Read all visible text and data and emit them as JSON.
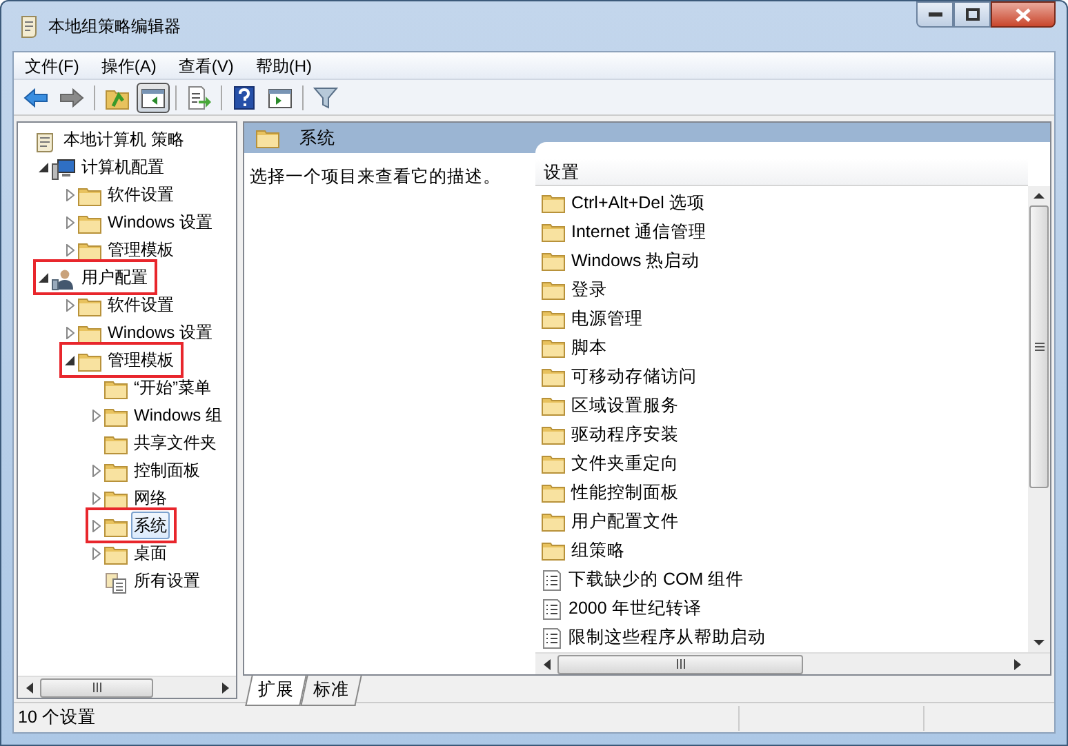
{
  "window": {
    "title": "本地组策略编辑器"
  },
  "menu": [
    "文件(F)",
    "操作(A)",
    "查看(V)",
    "帮助(H)"
  ],
  "toolbar": [
    {
      "kind": "back",
      "pressed": false
    },
    {
      "kind": "forward",
      "pressed": false
    },
    {
      "kind": "sep"
    },
    {
      "kind": "up",
      "pressed": false
    },
    {
      "kind": "tree",
      "pressed": true
    },
    {
      "kind": "sep"
    },
    {
      "kind": "export",
      "pressed": false
    },
    {
      "kind": "sep"
    },
    {
      "kind": "help",
      "pressed": false
    },
    {
      "kind": "view",
      "pressed": false
    },
    {
      "kind": "sep"
    },
    {
      "kind": "filter",
      "pressed": false
    }
  ],
  "tree": [
    {
      "text": "本地计算机 策略",
      "kind": "scroll",
      "selected": false,
      "highlighted": false,
      "children": [
        {
          "text": "计算机配置",
          "kind": "computer",
          "expanded": true,
          "selected": false,
          "highlighted": false,
          "children": [
            {
              "text": "软件设置",
              "kind": "folder",
              "expanded": false,
              "selected": false,
              "highlighted": false
            },
            {
              "text": "Windows 设置",
              "kind": "folder",
              "expanded": false,
              "selected": false,
              "highlighted": false
            },
            {
              "text": "管理模板",
              "kind": "folder",
              "expanded": false,
              "selected": false,
              "highlighted": false
            }
          ]
        },
        {
          "text": "用户配置",
          "kind": "user",
          "expanded": true,
          "selected": false,
          "highlighted": true,
          "children": [
            {
              "text": "软件设置",
              "kind": "folder",
              "expanded": false,
              "selected": false,
              "highlighted": false
            },
            {
              "text": "Windows 设置",
              "kind": "folder",
              "expanded": false,
              "selected": false,
              "highlighted": false
            },
            {
              "text": "管理模板",
              "kind": "folder",
              "expanded": true,
              "selected": false,
              "highlighted": true,
              "children": [
                {
                  "text": "“开始”菜单",
                  "kind": "folder",
                  "selected": false,
                  "highlighted": false
                },
                {
                  "text": "Windows 组",
                  "kind": "folder",
                  "expanded": false,
                  "selected": false,
                  "highlighted": false
                },
                {
                  "text": "共享文件夹",
                  "kind": "folder",
                  "selected": false,
                  "highlighted": false
                },
                {
                  "text": "控制面板",
                  "kind": "folder",
                  "expanded": false,
                  "selected": false,
                  "highlighted": false
                },
                {
                  "text": "网络",
                  "kind": "folder",
                  "expanded": false,
                  "selected": false,
                  "highlighted": false
                },
                {
                  "text": "系统",
                  "kind": "folder",
                  "expanded": false,
                  "selected": true,
                  "highlighted": true
                },
                {
                  "text": "桌面",
                  "kind": "folder",
                  "expanded": false,
                  "selected": false,
                  "highlighted": false
                },
                {
                  "text": "所有设置",
                  "kind": "allsettings",
                  "selected": false,
                  "highlighted": false
                }
              ]
            }
          ]
        }
      ]
    }
  ],
  "details": {
    "title": "系统",
    "description": "选择一个项目来查看它的描述。",
    "column": "设置",
    "items": [
      {
        "text": "Ctrl+Alt+Del 选项",
        "kind": "folder"
      },
      {
        "text": "Internet 通信管理",
        "kind": "folder"
      },
      {
        "text": "Windows 热启动",
        "kind": "folder"
      },
      {
        "text": "登录",
        "kind": "folder"
      },
      {
        "text": "电源管理",
        "kind": "folder"
      },
      {
        "text": "脚本",
        "kind": "folder"
      },
      {
        "text": "可移动存储访问",
        "kind": "folder"
      },
      {
        "text": "区域设置服务",
        "kind": "folder"
      },
      {
        "text": "驱动程序安装",
        "kind": "folder"
      },
      {
        "text": "文件夹重定向",
        "kind": "folder"
      },
      {
        "text": "性能控制面板",
        "kind": "folder"
      },
      {
        "text": "用户配置文件",
        "kind": "folder"
      },
      {
        "text": "组策略",
        "kind": "folder"
      },
      {
        "text": "下载缺少的 COM 组件",
        "kind": "setting"
      },
      {
        "text": "2000 年世纪转译",
        "kind": "setting"
      },
      {
        "text": "限制这些程序从帮助启动",
        "kind": "setting"
      }
    ]
  },
  "tabs": [
    {
      "label": "扩展",
      "selected": true
    },
    {
      "label": "标准",
      "selected": false
    }
  ],
  "status_bar": "10 个设置"
}
